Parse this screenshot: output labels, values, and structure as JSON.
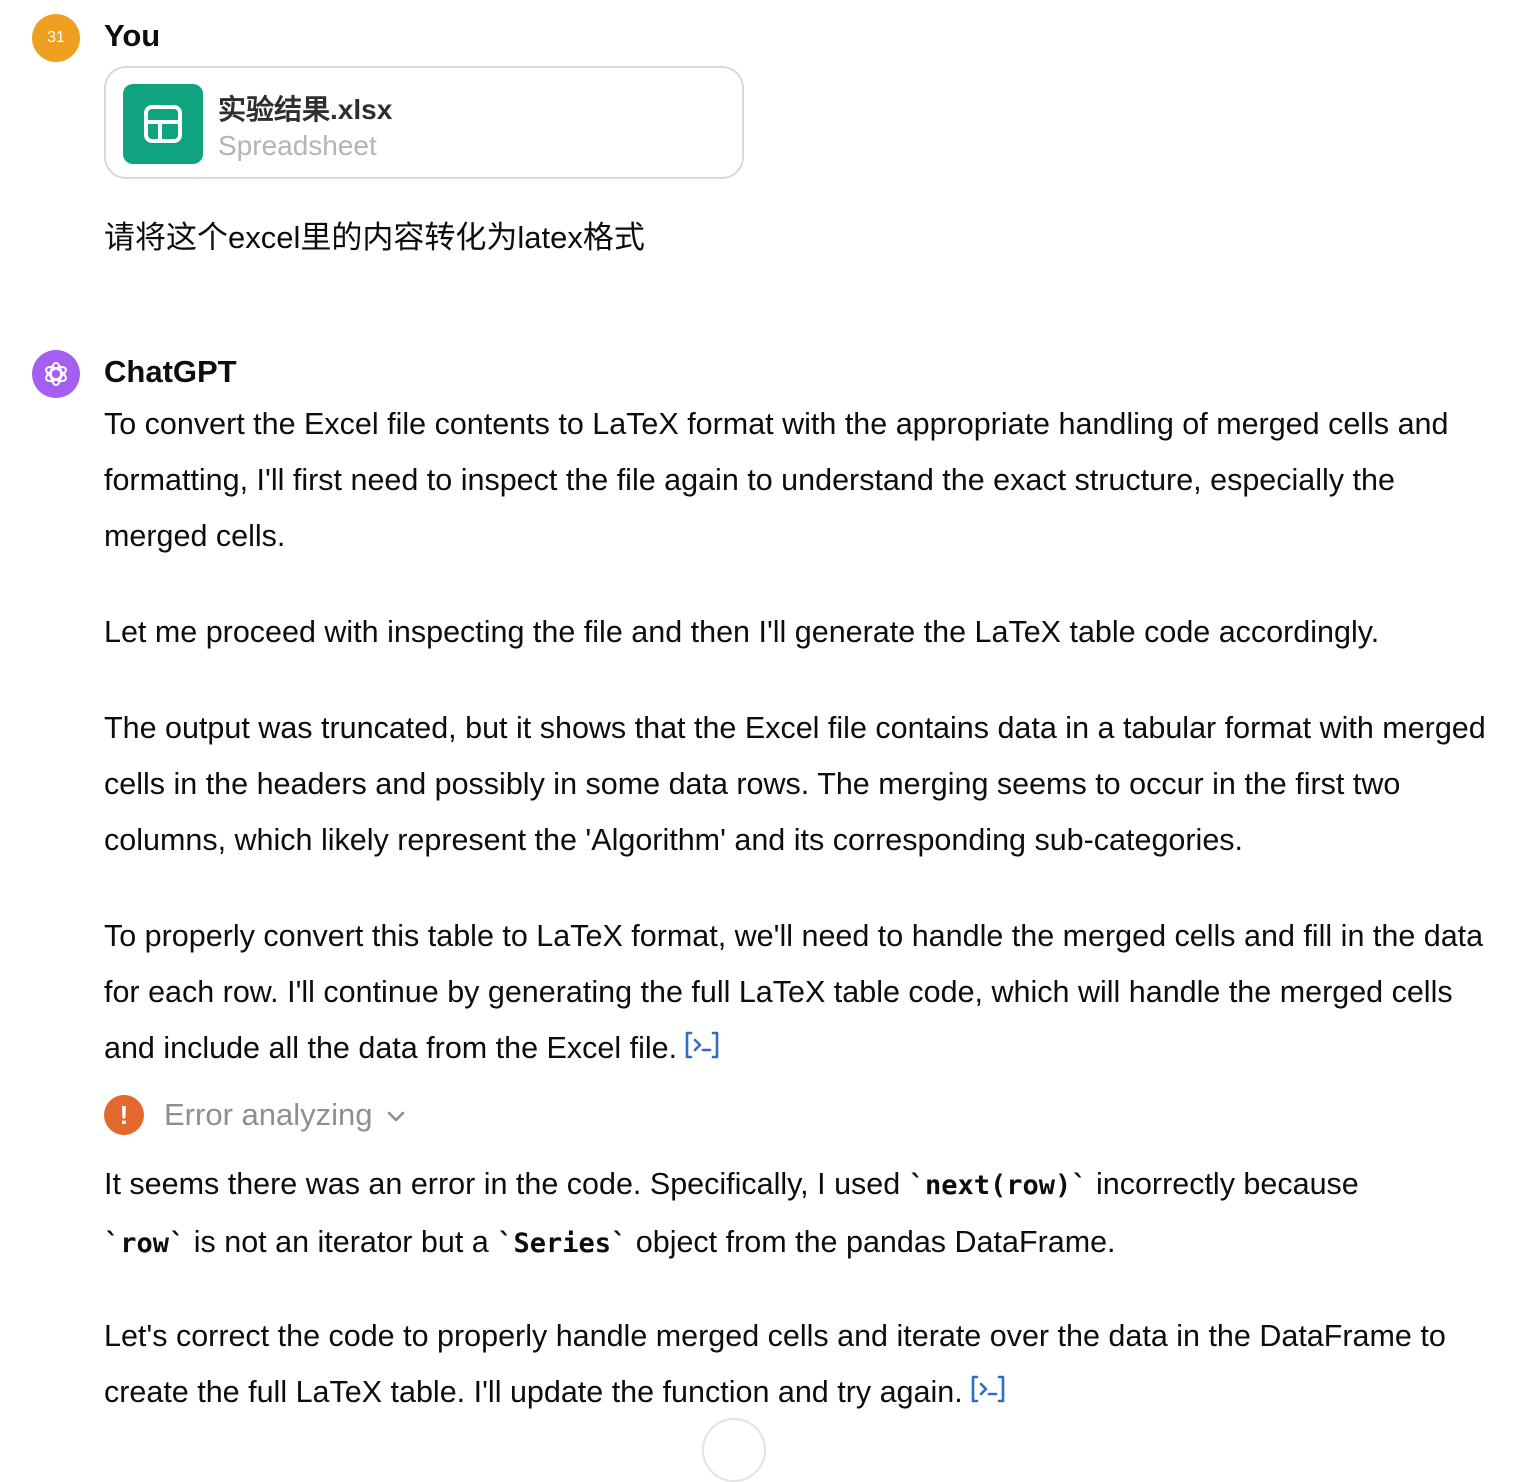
{
  "user_message": {
    "avatar_text": "31",
    "sender": "You",
    "attachment": {
      "filename": "实验结果.xlsx",
      "filetype": "Spreadsheet",
      "icon": "spreadsheet-icon",
      "icon_color": "#10a37f"
    },
    "text": "请将这个excel里的内容转化为latex格式"
  },
  "assistant_message": {
    "sender": "ChatGPT",
    "avatar_icon": "openai-logo-icon",
    "avatar_color": "#a55ef0",
    "paragraph_1": "To convert the Excel file contents to LaTeX format with the appropriate handling of merged cells and formatting, I'll first need to inspect the file again to understand the exact structure, especially the merged cells.",
    "paragraph_2": "Let me proceed with inspecting the file and then I'll generate the LaTeX table code accordingly.",
    "paragraph_3": "The output was truncated, but it shows that the Excel file contains data in a tabular format with merged cells in the headers and possibly in some data rows. The merging seems to occur in the first two columns, which likely represent the 'Algorithm' and its corresponding sub-categories.",
    "paragraph_4": "To properly convert this table to LaTeX format, we'll need to handle the merged cells and fill in the data for each row. I'll continue by generating the full LaTeX table code, which will handle the merged cells and include all the data from the Excel file.",
    "error_status": {
      "label": "Error analyzing",
      "icon": "exclamation-icon",
      "icon_color": "#e2682e"
    },
    "paragraph_5": {
      "part_1": "It seems there was an error in the code. Specifically, I used ",
      "code_1": "`next(row)`",
      "part_2": " incorrectly because ",
      "code_2": "`row`",
      "part_3": " is not an iterator but a ",
      "code_3": "`Series`",
      "part_4": " object from the pandas DataFrame."
    },
    "paragraph_6": "Let's correct the code to properly handle merged cells and iterate over the data in the DataFrame to create the full LaTeX table. I'll update the function and try again.",
    "code_link_icon": "view-analysis-icon",
    "code_link_color": "#2f6ec2"
  }
}
